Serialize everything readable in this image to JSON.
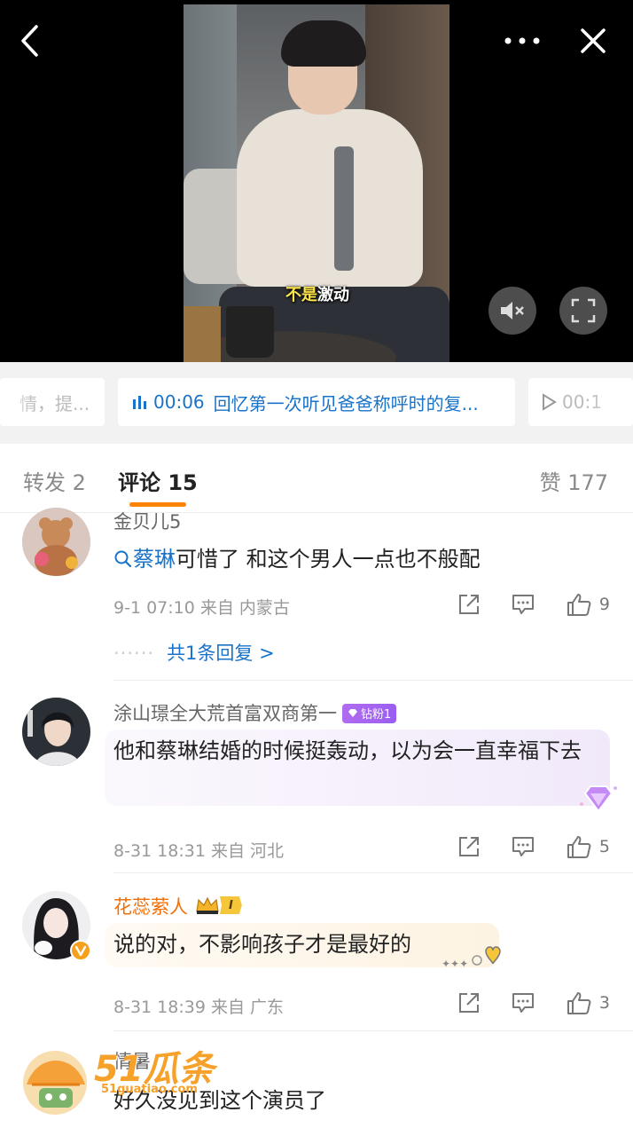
{
  "video": {
    "subtitle_highlight": "不是",
    "subtitle_rest": "激动"
  },
  "chapters": {
    "prev_label": "情，提...",
    "current_time": "00:06",
    "current_label": "回忆第一次听见爸爸称呼时的复...",
    "next_time": "00:1"
  },
  "tabs": {
    "repost": "转发 2",
    "comments": "评论 15",
    "likes": "赞 177"
  },
  "comments": [
    {
      "user": "金贝儿5",
      "topic": "蔡琳",
      "text": "可惜了 和这个男人一点也不般配",
      "time": "9-1 07:10",
      "from": "来自 内蒙古",
      "likes": "9",
      "replies": "共1条回复 >"
    },
    {
      "user": "涂山璟全大荒首富双商第一",
      "badge": "钻粉1",
      "text": "他和蔡琳结婚的时候挺轰动，以为会一直幸福下去",
      "time": "8-31 18:31",
      "from": "来自 河北",
      "likes": "5"
    },
    {
      "user": "花蕊萦人",
      "badge": "I",
      "text": "说的对，不影响孩子才是最好的",
      "time": "8-31 18:39",
      "from": "来自 广东",
      "likes": "3"
    },
    {
      "user": "情暑",
      "text": "好久没见到这个演员了"
    }
  ],
  "watermark": {
    "logo": "51瓜条",
    "site": "51guatiao.com"
  },
  "colors": {
    "link": "#1a73c8",
    "accent": "#ff8200",
    "vip_name": "#f0700a"
  }
}
